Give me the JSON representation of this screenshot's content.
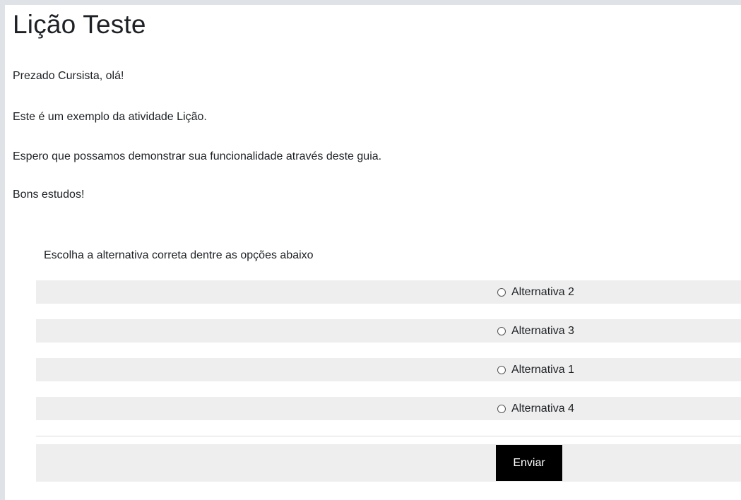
{
  "lesson": {
    "title": "Lição Teste",
    "paragraphs": [
      "Prezado Cursista, olá!",
      "Este é um exemplo da atividade Lição.",
      "Espero que possamos demonstrar sua funcionalidade através deste guia.",
      "Bons estudos!"
    ]
  },
  "question": {
    "prompt": "Escolha a alternativa correta dentre as opções abaixo",
    "options": [
      {
        "label": "Alternativa 2",
        "selected": false
      },
      {
        "label": "Alternativa 3",
        "selected": false
      },
      {
        "label": "Alternativa 1",
        "selected": false
      },
      {
        "label": "Alternativa 4",
        "selected": false
      }
    ],
    "submit_label": "Enviar"
  },
  "colors": {
    "page_background": "#dfe3e7",
    "content_background": "#ffffff",
    "row_background": "#eeeeee",
    "button_background": "#000000",
    "button_text": "#ffffff"
  }
}
